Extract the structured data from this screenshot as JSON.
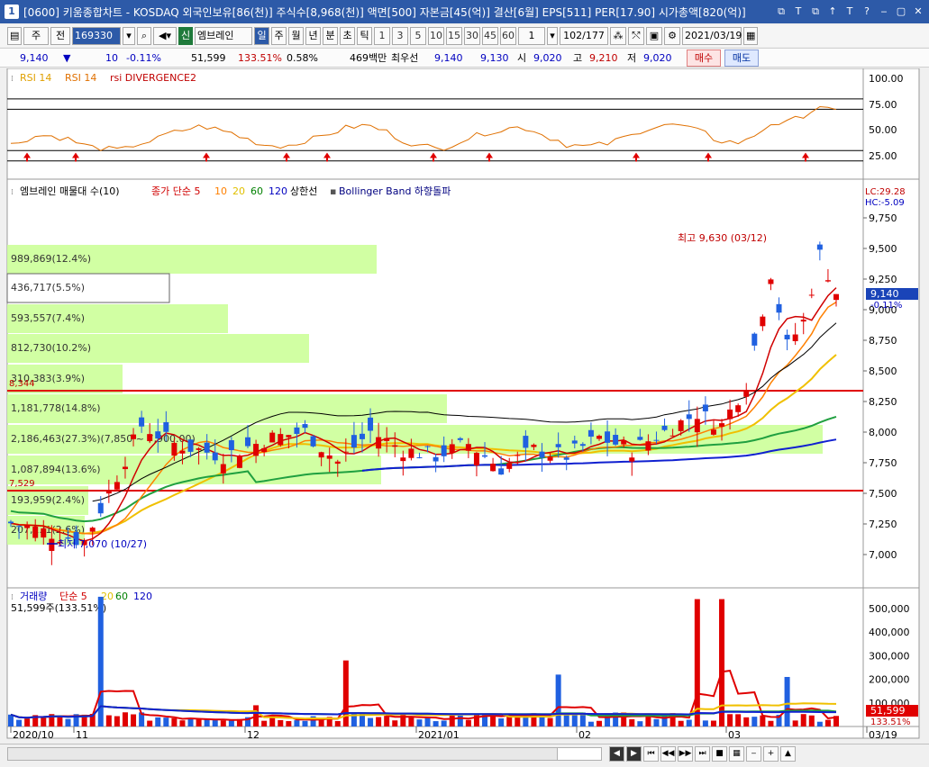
{
  "window": {
    "title": "[0600] 키움종합차트 - KOSDAQ 외국인보유[86(천)] 주식수[8,968(천)] 액면[500] 자본금[45(억)] 결산[6월] EPS[511] PER[17.90] 시가총액[820(억)]",
    "icon_label": "1",
    "controls": [
      "⧉",
      "T",
      "⧉",
      "↑",
      "T",
      "?",
      "‒",
      "▢",
      "✕"
    ]
  },
  "toolbar": {
    "market_label": "주",
    "prev_label": "전",
    "stock_code": "169330",
    "stock_name": "엠브레인",
    "new_label": "신",
    "periods": [
      "일",
      "주",
      "월",
      "년",
      "분",
      "초",
      "틱"
    ],
    "selected_period": "일",
    "intervals": [
      "1",
      "3",
      "5",
      "10",
      "15",
      "30",
      "45",
      "60"
    ],
    "interval_value": "1",
    "page_counter": "102/177",
    "date": "2021/03/19"
  },
  "quote": {
    "price": "9,140",
    "price_arrow": "▼",
    "change": "10",
    "change_pct": "-0.11%",
    "volume": "51,599",
    "volume_ratio": "133.51%",
    "turnover": "0.58%",
    "amount": "469백만",
    "best_ask_label": "최우선",
    "best_ask": "9,140",
    "best_bid": "9,130",
    "open_label": "시",
    "open": "9,020",
    "high_label": "고",
    "high": "9,210",
    "low_label": "저",
    "low": "9,020",
    "buy_label": "매수",
    "sell_label": "매도"
  },
  "rsi_panel": {
    "legend": [
      {
        "text": "RSI 14",
        "color": "#e0a000"
      },
      {
        "text": "RSI 14",
        "color": "#e07000"
      },
      {
        "text": "rsi DIVERGENCE2",
        "color": "#c00000"
      }
    ],
    "y_labels": [
      "100.00",
      "75.00",
      "50.00",
      "25.00"
    ]
  },
  "price_panel": {
    "legend": [
      {
        "text": "엠브레인 매물대 수(10)",
        "color": "#000000"
      },
      {
        "text": "종가 단순 5",
        "color": "#d00000"
      },
      {
        "text": "10",
        "color": "#ff8000"
      },
      {
        "text": "20",
        "color": "#e0c000"
      },
      {
        "text": "60",
        "color": "#008000"
      },
      {
        "text": "120",
        "color": "#0000c0"
      },
      {
        "text": "상한선",
        "color": "#000000"
      },
      {
        "text": "Bollinger Band 하향돌파",
        "color": "#000080"
      }
    ],
    "lc_label": "LC:29.28",
    "hc_label": "HC:-5.09",
    "y_labels": [
      "9,750",
      "9,500",
      "9,250",
      "9,000",
      "8,750",
      "8,500",
      "8,250",
      "8,000",
      "7,750",
      "7,500",
      "7,250",
      "7,000"
    ],
    "current_price_tag": "9,140",
    "current_change_tag": "-0.11%",
    "high_annotation": "최고 9,630 (03/12)",
    "low_annotation": "최저 7,070 (10/27)",
    "level_upper": "8,344",
    "level_lower": "7,529",
    "volume_profile": [
      "989,869(12.4%)",
      "436,717(5.5%)",
      "593,557(7.4%)",
      "812,730(10.2%)",
      "310,383(3.9%)",
      "1,181,778(14.8%)",
      "2,186,463(27.3%)(7,850 ~ 7,900.00)",
      "1,087,894(13.6%)",
      "193,959(2.4%)",
      "207,131(2.6%)"
    ]
  },
  "volume_panel": {
    "legend": [
      {
        "text": "거래량",
        "color": "#0000c0"
      },
      {
        "text": "단순 5",
        "color": "#d00000"
      },
      {
        "text": "20",
        "color": "#e0c000"
      },
      {
        "text": "60",
        "color": "#008000"
      },
      {
        "text": "120",
        "color": "#0000c0"
      }
    ],
    "sub_label": "51,599주(133.51%)",
    "y_labels": [
      "500,000",
      "400,000",
      "300,000",
      "200,000",
      "100,000"
    ],
    "current_tag": "51,599",
    "current_pct_tag": "133.51%"
  },
  "x_axis": [
    "2020/10",
    "11",
    "12",
    "2021/01",
    "02",
    "03",
    "03/19"
  ],
  "nav_buttons": [
    "◀",
    "▶",
    "⏮",
    "◀◀",
    "▶▶",
    "⏭",
    "■",
    "▦",
    "‒",
    "+",
    "▲"
  ],
  "chart_data": {
    "type": "candlestick",
    "ohlc_approx": [
      {
        "date": "2020/10/27",
        "low": 7070
      },
      {
        "date": "2021/03/12",
        "high": 9630
      },
      {
        "date": "2021/03/19",
        "open": 9020,
        "high": 9210,
        "low": 9020,
        "close": 9140
      }
    ]
  }
}
